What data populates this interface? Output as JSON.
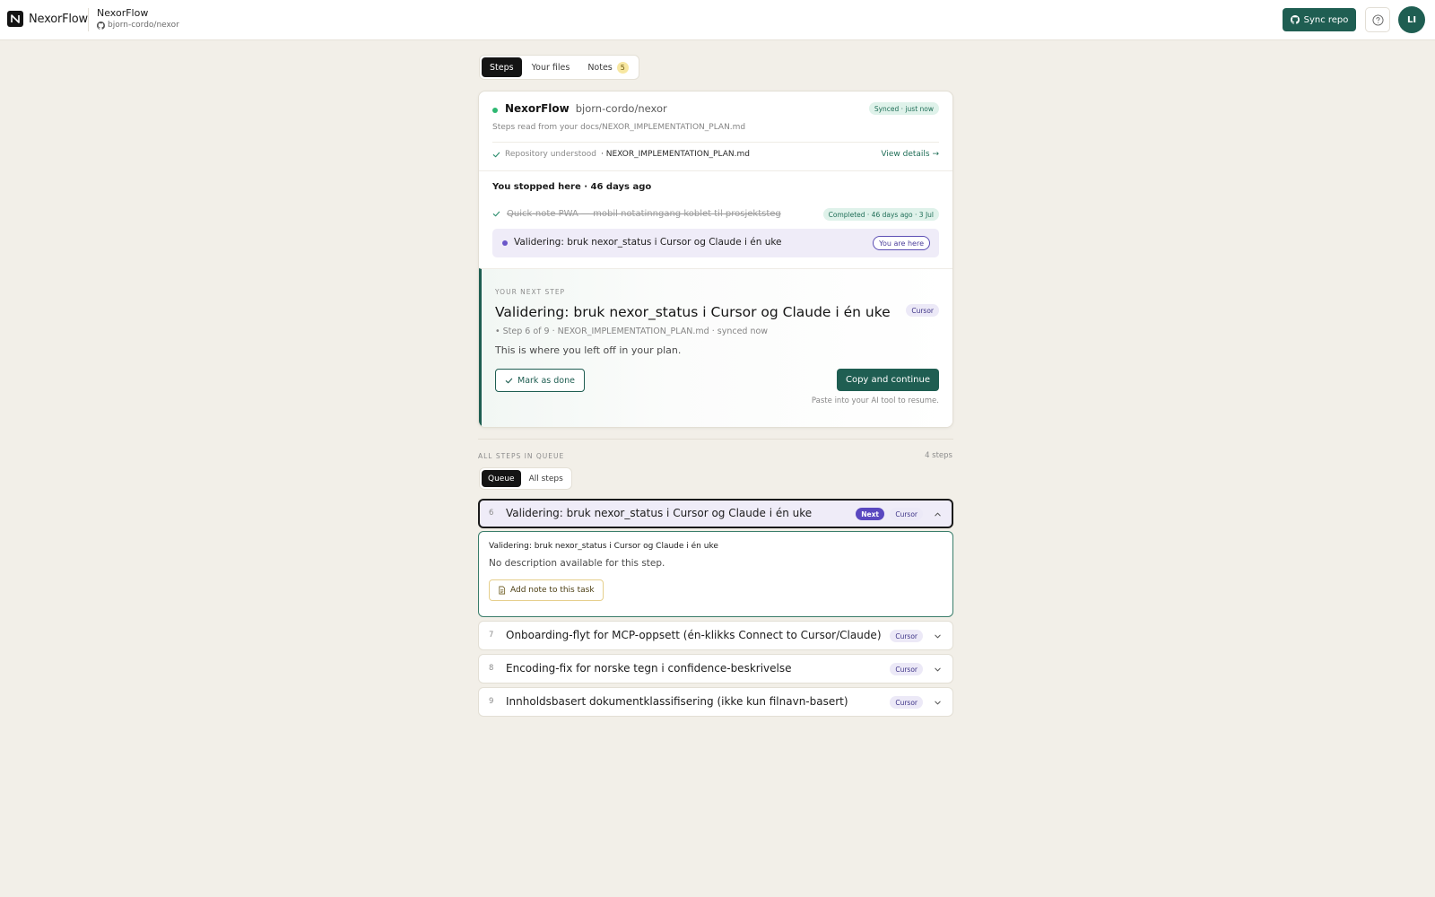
{
  "header": {
    "brand": "NexorFlow",
    "project_name": "NexorFlow",
    "project_repo": "bjorn-cordo/nexor",
    "sync_label": "Sync repo",
    "avatar_initials": "LI"
  },
  "tabs": [
    {
      "label": "Steps",
      "active": true
    },
    {
      "label": "Your files",
      "active": false
    },
    {
      "label": "Notes",
      "active": false,
      "badge": "5"
    }
  ],
  "repo_card": {
    "name": "NexorFlow",
    "repo": "bjorn-cordo/nexor",
    "sync_status": "Synced · just now",
    "subtitle": "Steps read from your docs/NEXOR_IMPLEMENTATION_PLAN.md",
    "understood_label": "Repository understood",
    "understood_file": "· NEXOR_IMPLEMENTATION_PLAN.md",
    "view_details": "View details →"
  },
  "stopped": {
    "title": "You stopped here · 46 days ago",
    "completed_step": "Quick-note PWA — mobil notatinngang koblet til prosjektsteg",
    "completed_badge": "Completed · 46 days ago · 3 Jul",
    "current_step": "Validering: bruk nexor_status i Cursor og Claude i én uke",
    "current_badge": "You are here"
  },
  "next_step": {
    "label": "YOUR NEXT STEP",
    "title": "Validering: bruk nexor_status i Cursor og Claude i én uke",
    "tool": "Cursor",
    "meta": "• Step 6 of 9 · NEXOR_IMPLEMENTATION_PLAN.md · synced now",
    "description": "This is where you left off in your plan.",
    "mark_done": "Mark as done",
    "copy_continue": "Copy and continue",
    "hint": "Paste into your AI tool to resume."
  },
  "queue": {
    "label": "ALL STEPS IN QUEUE",
    "count": "4 steps",
    "tabs": [
      {
        "label": "Queue",
        "active": true
      },
      {
        "label": "All steps",
        "active": false
      }
    ],
    "next_badge": "Next",
    "steps": [
      {
        "num": "6",
        "title": "Validering: bruk nexor_status i Cursor og Claude i én uke",
        "tool": "Cursor",
        "expanded": true
      },
      {
        "num": "7",
        "title": "Onboarding-flyt for MCP-oppsett (én-klikks Connect to Cursor/Claude)",
        "tool": "Cursor",
        "expanded": false
      },
      {
        "num": "8",
        "title": "Encoding-fix for norske tegn i confidence-beskrivelse",
        "tool": "Cursor",
        "expanded": false
      },
      {
        "num": "9",
        "title": "Innholdsbasert dokumentklassifisering (ikke kun filnavn-basert)",
        "tool": "Cursor",
        "expanded": false
      }
    ],
    "expanded_detail": {
      "title": "Validering: bruk nexor_status i Cursor og Claude i én uke",
      "description": "No description available for this step.",
      "add_note": "Add note to this task"
    }
  },
  "colors": {
    "brand_green": "#1f5e52",
    "accent_purple": "#5a48c0",
    "background": "#f2efe8"
  }
}
